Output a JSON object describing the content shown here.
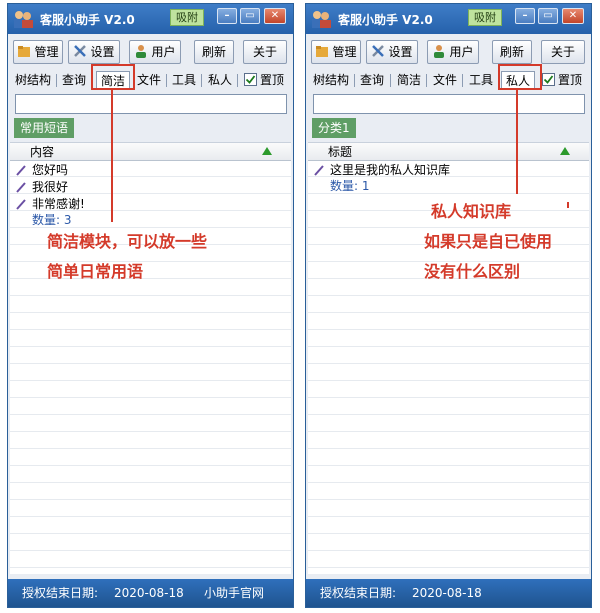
{
  "app": {
    "title": "客服小助手 V2.0",
    "pin_badge": "吸附",
    "window_controls": {
      "minimize": "–",
      "restore": "▭",
      "close": "✕"
    }
  },
  "toolbar": {
    "manage": "管理",
    "settings": "设置",
    "users": "用户",
    "refresh": "刷新",
    "about": "关于"
  },
  "tabs": [
    "树结构",
    "查询",
    "简洁",
    "文件",
    "工具",
    "私人"
  ],
  "pin_top_label": "置顶",
  "left": {
    "active_tab": "简洁",
    "category": "常用短语",
    "column_header": "内容",
    "rows": [
      "您好吗",
      "我很好",
      "非常感谢!"
    ],
    "count": "数量: 3",
    "annotation": [
      "简洁模块，可以放一些",
      "简单日常用语"
    ],
    "status": {
      "label": "授权结束日期:",
      "date": "2020-08-18",
      "link": "小助手官网"
    }
  },
  "right": {
    "active_tab": "私人",
    "category": "分类1",
    "column_header": "标题",
    "rows": [
      "这里是我的私人知识库"
    ],
    "count": "数量: 1",
    "annotation": [
      "私人知识库",
      "如果只是自已使用",
      "没有什么区别"
    ],
    "status": {
      "label": "授权结束日期:",
      "date": "2020-08-18"
    }
  },
  "colors": {
    "titlebar": "#2561ab",
    "category_tag": "#5f9e65",
    "annotation": "#d43a2a",
    "count_text": "#2b58a8",
    "sort_arrow": "#2c9a2c"
  }
}
